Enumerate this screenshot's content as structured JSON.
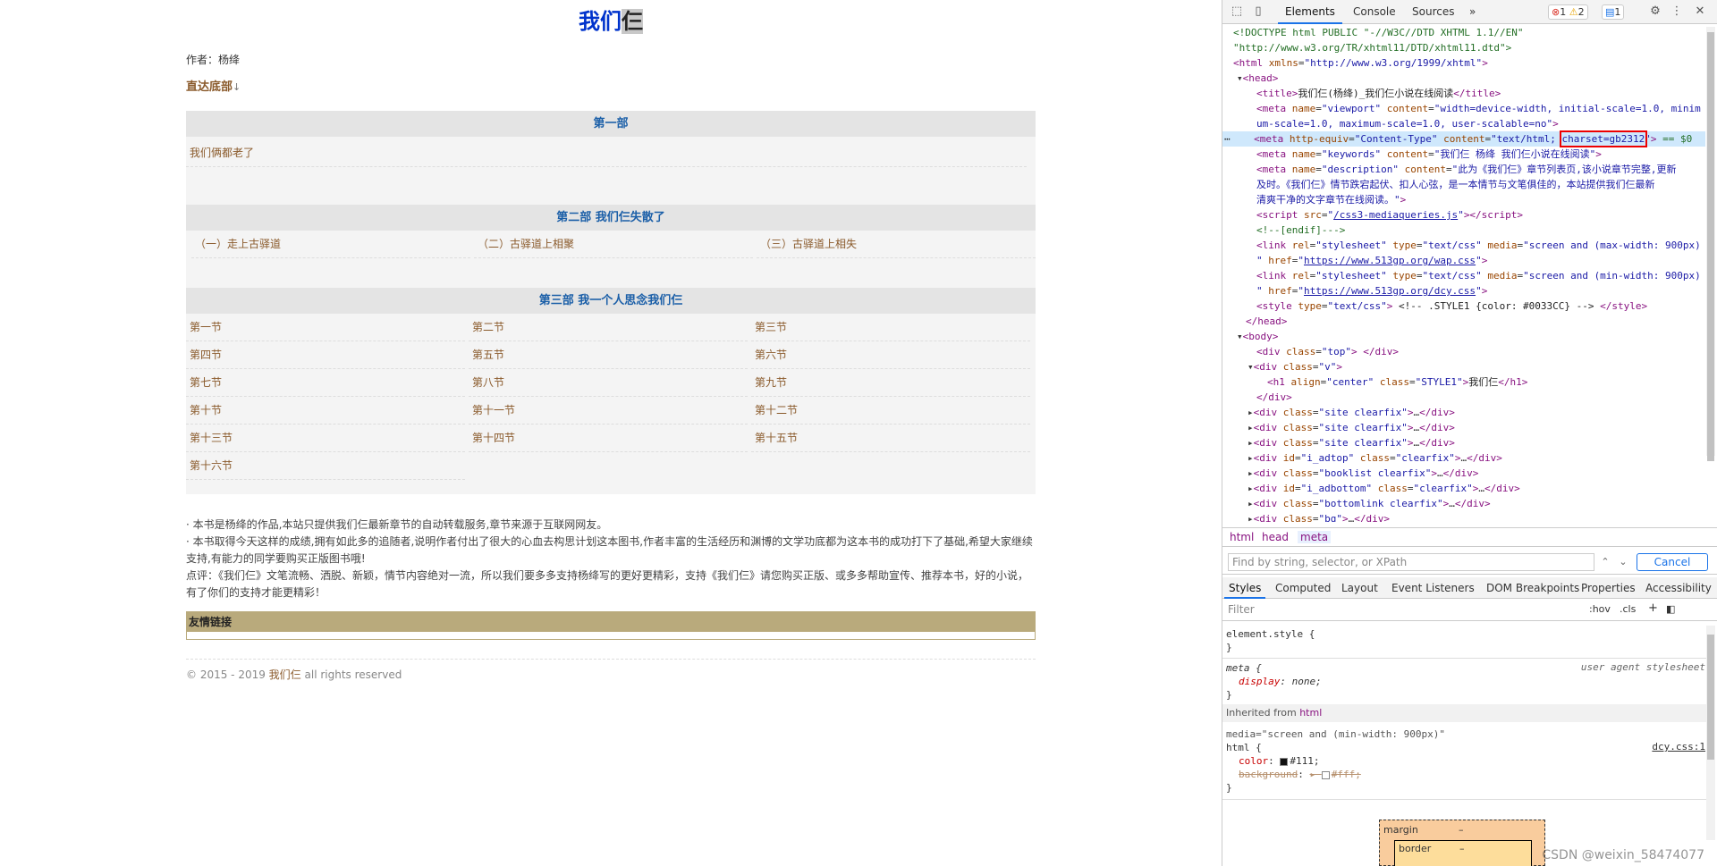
{
  "page": {
    "title_part1": "我们",
    "title_part2": "仨",
    "author": "作者：杨绛",
    "to_bottom": "直达底部",
    "to_bottom_caret": "↓",
    "parts": [
      {
        "heading": "第一部",
        "items": [
          "我们俩都老了"
        ]
      },
      {
        "heading": "第二部 我们仨失散了",
        "items": [
          "（一）走上古驿道",
          "（二）古驿道上相聚",
          "（三）古驿道上相失"
        ]
      },
      {
        "heading": "第三部 我一个人思念我们仨",
        "items": [
          "第一节",
          "第二节",
          "第三节",
          "第四节",
          "第五节",
          "第六节",
          "第七节",
          "第八节",
          "第九节",
          "第十节",
          "第十一节",
          "第十二节",
          "第十三节",
          "第十四节",
          "第十五节",
          "第十六节"
        ]
      }
    ],
    "notes": [
      "· 本书是杨绛的作品,本站只提供我们仨最新章节的自动转载服务,章节来源于互联网网友。",
      "· 本书取得今天这样的成绩,拥有如此多的追随者,说明作者付出了很大的心血去构思计划这本图书,作者丰富的生活经历和渊博的文学功底都为这本书的成功打下了基础,希望大家继续支持,有能力的同学要购买正版图书哦!",
      "点评：《我们仨》文笔流畅、洒脱、新颖，情节内容绝对一流，所以我们要多多支持杨绛写的更好更精彩，支持《我们仨》请您购买正版、或多多帮助宣传、推荐本书，好的小说，有了你们的支持才能更精彩！"
    ],
    "friends_heading": "友情链接",
    "footer_prefix": "© 2015 - 2019 ",
    "footer_site": "我们仨",
    "footer_suffix": " all rights reserved"
  },
  "devtools": {
    "tabs": [
      "Elements",
      "Console",
      "Sources",
      "»"
    ],
    "errors": "1",
    "warnings": "2",
    "messages": "1",
    "dom_lines": [
      {
        "html": "<span class='cm'>&lt;!DOCTYPE html PUBLIC \"-//W3C//DTD XHTML 1.1//EN\"</span>"
      },
      {
        "html": "<span class='cm'>\"http://www.w3.org/TR/xhtml11/DTD/xhtml11.dtd\"&gt;</span>"
      }
    ],
    "breadcrumbs": [
      "html",
      "head",
      "meta"
    ],
    "find_placeholder": "Find by string, selector, or XPath",
    "cancel_label": "Cancel",
    "subtabs": [
      "Styles",
      "Computed",
      "Layout",
      "Event Listeners",
      "DOM Breakpoints",
      "Properties",
      "Accessibility"
    ],
    "filter_placeholder": "Filter",
    "filter_hov": ":hov",
    "filter_cls": ".cls",
    "filter_plus": "+",
    "style_element": "element.style {",
    "style_close": "}",
    "style_meta_sel": "meta {",
    "style_meta_src": "user agent stylesheet",
    "style_meta_prop": "display",
    "style_meta_val": "none;",
    "inherited_label": "Inherited from",
    "inherited_tag": "html",
    "media_line": "media=\"screen and (min-width: 900px)\"",
    "html_rule_sel": "html {",
    "html_rule_src": "dcy.css:1",
    "color_prop": "color",
    "color_val": "#111;",
    "bg_prop": "background",
    "bg_val": "#fff;",
    "box_margin": "margin",
    "box_border": "border",
    "box_dash": "–",
    "watermark": "CSDN @weixin_58474077"
  },
  "colors": {
    "title": "#0033CC",
    "link": "#8a5a2b",
    "part_heading": "#1b5fa8",
    "friends_bar": "#b9aa7c",
    "devtools_accent": "#1a73e8"
  }
}
